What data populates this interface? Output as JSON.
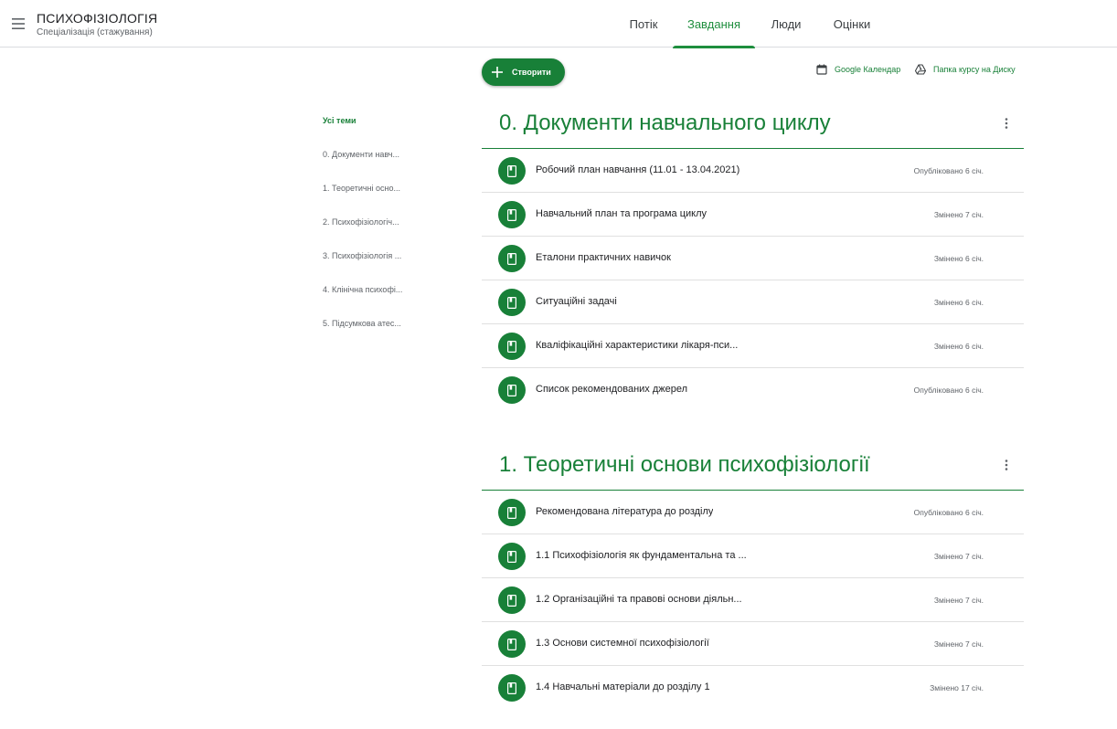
{
  "header": {
    "course_title": "ПСИХОФІЗІОЛОГІЯ",
    "course_subtitle": "Спеціалізація (стажування)",
    "tabs": [
      {
        "label": "Потік"
      },
      {
        "label": "Завдання"
      },
      {
        "label": "Люди"
      },
      {
        "label": "Оцінки"
      }
    ],
    "active_tab": "Завдання"
  },
  "toolbar": {
    "create_label": "Створити",
    "calendar_label": "Google Календар",
    "drive_label": "Папка курсу на Диску"
  },
  "topics": [
    {
      "label": "Усі теми"
    },
    {
      "label": "0. Документи навч..."
    },
    {
      "label": "1. Теоретичні осно..."
    },
    {
      "label": "2. Психофізіологіч..."
    },
    {
      "label": "3. Психофізіологія ..."
    },
    {
      "label": "4. Клінічна психофі..."
    },
    {
      "label": "5. Підсумкова атес..."
    }
  ],
  "sections": [
    {
      "title": "0. Документи навчального циклу",
      "items": [
        {
          "title": "Робочий план навчання (11.01 - 13.04.2021)",
          "status": "Опубліковано 6 січ."
        },
        {
          "title": "Навчальний план та програма циклу",
          "status": "Змінено 7 січ."
        },
        {
          "title": "Еталони практичних навичок",
          "status": "Змінено 6 січ."
        },
        {
          "title": "Ситуаційні задачі",
          "status": "Змінено 6 січ."
        },
        {
          "title": "Кваліфікаційні характеристики лікаря-пси...",
          "status": "Змінено 6 січ."
        },
        {
          "title": "Список рекомендованих джерел",
          "status": "Опубліковано 6 січ."
        }
      ]
    },
    {
      "title": "1. Теоретичні основи психофізіології",
      "items": [
        {
          "title": "Рекомендована література до розділу",
          "status": "Опубліковано 6 січ."
        },
        {
          "title": "1.1 Психофізіологія як фундаментальна та ...",
          "status": "Змінено 7 січ."
        },
        {
          "title": "1.2 Організаційні та правові основи діяльн...",
          "status": "Змінено 7 січ."
        },
        {
          "title": "1.3 Основи системної психофізіології",
          "status": "Змінено 7 січ."
        },
        {
          "title": "1.4 Навчальні матеріали до розділу 1",
          "status": "Змінено 17 січ."
        }
      ]
    }
  ],
  "colors": {
    "accent": "#188038",
    "divider": "#e0e0e0"
  },
  "icons": {
    "menu": "menu-icon",
    "create": "plus-icon",
    "calendar": "calendar-icon",
    "drive": "drive-icon",
    "item": "material-icon",
    "more": "more-vert-icon"
  }
}
